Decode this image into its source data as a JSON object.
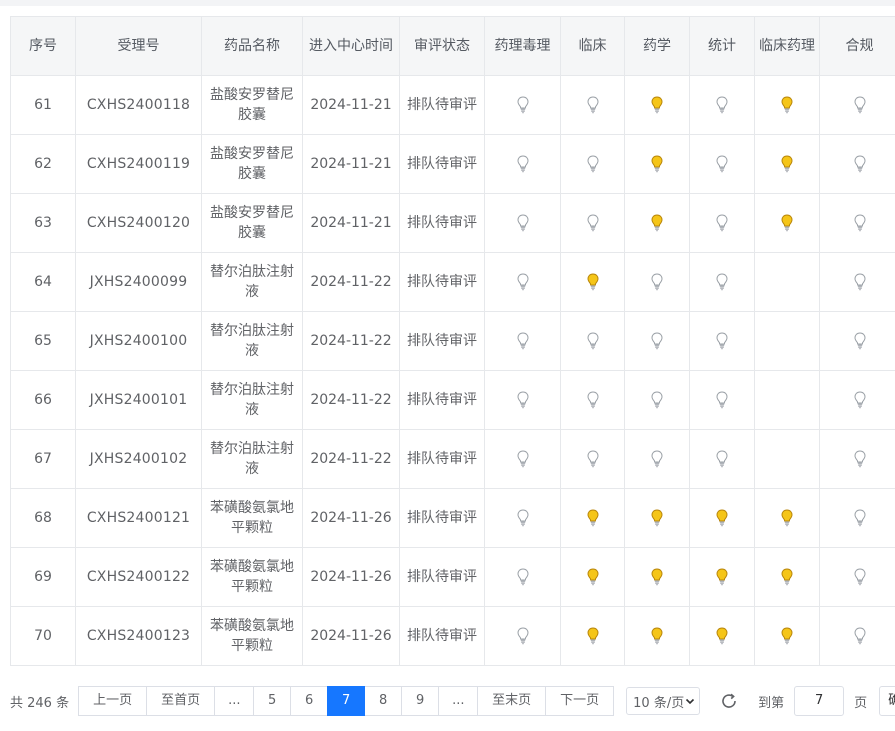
{
  "colors": {
    "bulb_on": "#f5c518",
    "bulb_off": "#ffffff",
    "active_page": "#1677ff"
  },
  "table": {
    "headers": [
      "序号",
      "受理号",
      "药品名称",
      "进入中心时间",
      "审评状态",
      "药理毒理",
      "临床",
      "药学",
      "统计",
      "临床药理",
      "合规"
    ],
    "rows": [
      {
        "no": "61",
        "code": "CXHS2400118",
        "name": "盐酸安罗替尼胶囊",
        "date": "2024-11-21",
        "status": "排队待审评",
        "lights": [
          "off",
          "off",
          "on",
          "off",
          "on",
          "off"
        ]
      },
      {
        "no": "62",
        "code": "CXHS2400119",
        "name": "盐酸安罗替尼胶囊",
        "date": "2024-11-21",
        "status": "排队待审评",
        "lights": [
          "off",
          "off",
          "on",
          "off",
          "on",
          "off"
        ]
      },
      {
        "no": "63",
        "code": "CXHS2400120",
        "name": "盐酸安罗替尼胶囊",
        "date": "2024-11-21",
        "status": "排队待审评",
        "lights": [
          "off",
          "off",
          "on",
          "off",
          "on",
          "off"
        ]
      },
      {
        "no": "64",
        "code": "JXHS2400099",
        "name": "替尔泊肽注射液",
        "date": "2024-11-22",
        "status": "排队待审评",
        "lights": [
          "off",
          "on",
          "off",
          "off",
          "none",
          "off"
        ]
      },
      {
        "no": "65",
        "code": "JXHS2400100",
        "name": "替尔泊肽注射液",
        "date": "2024-11-22",
        "status": "排队待审评",
        "lights": [
          "off",
          "off",
          "off",
          "off",
          "none",
          "off"
        ]
      },
      {
        "no": "66",
        "code": "JXHS2400101",
        "name": "替尔泊肽注射液",
        "date": "2024-11-22",
        "status": "排队待审评",
        "lights": [
          "off",
          "off",
          "off",
          "off",
          "none",
          "off"
        ]
      },
      {
        "no": "67",
        "code": "JXHS2400102",
        "name": "替尔泊肽注射液",
        "date": "2024-11-22",
        "status": "排队待审评",
        "lights": [
          "off",
          "off",
          "off",
          "off",
          "none",
          "off"
        ]
      },
      {
        "no": "68",
        "code": "CXHS2400121",
        "name": "苯磺酸氨氯地平颗粒",
        "date": "2024-11-26",
        "status": "排队待审评",
        "lights": [
          "off",
          "on",
          "on",
          "on",
          "on",
          "off"
        ]
      },
      {
        "no": "69",
        "code": "CXHS2400122",
        "name": "苯磺酸氨氯地平颗粒",
        "date": "2024-11-26",
        "status": "排队待审评",
        "lights": [
          "off",
          "on",
          "on",
          "on",
          "on",
          "off"
        ]
      },
      {
        "no": "70",
        "code": "CXHS2400123",
        "name": "苯磺酸氨氯地平颗粒",
        "date": "2024-11-26",
        "status": "排队待审评",
        "lights": [
          "off",
          "on",
          "on",
          "on",
          "on",
          "off"
        ]
      }
    ]
  },
  "pager": {
    "total": "共 246 条",
    "prev": "上一页",
    "first": "至首页",
    "ellipsis": "...",
    "pages": [
      "5",
      "6",
      "7",
      "8",
      "9"
    ],
    "current": "7",
    "last": "至末页",
    "next": "下一页",
    "page_size": "10 条/页",
    "goto_label": "到第",
    "goto_value": "7",
    "page_unit": "页",
    "confirm": "确定"
  }
}
